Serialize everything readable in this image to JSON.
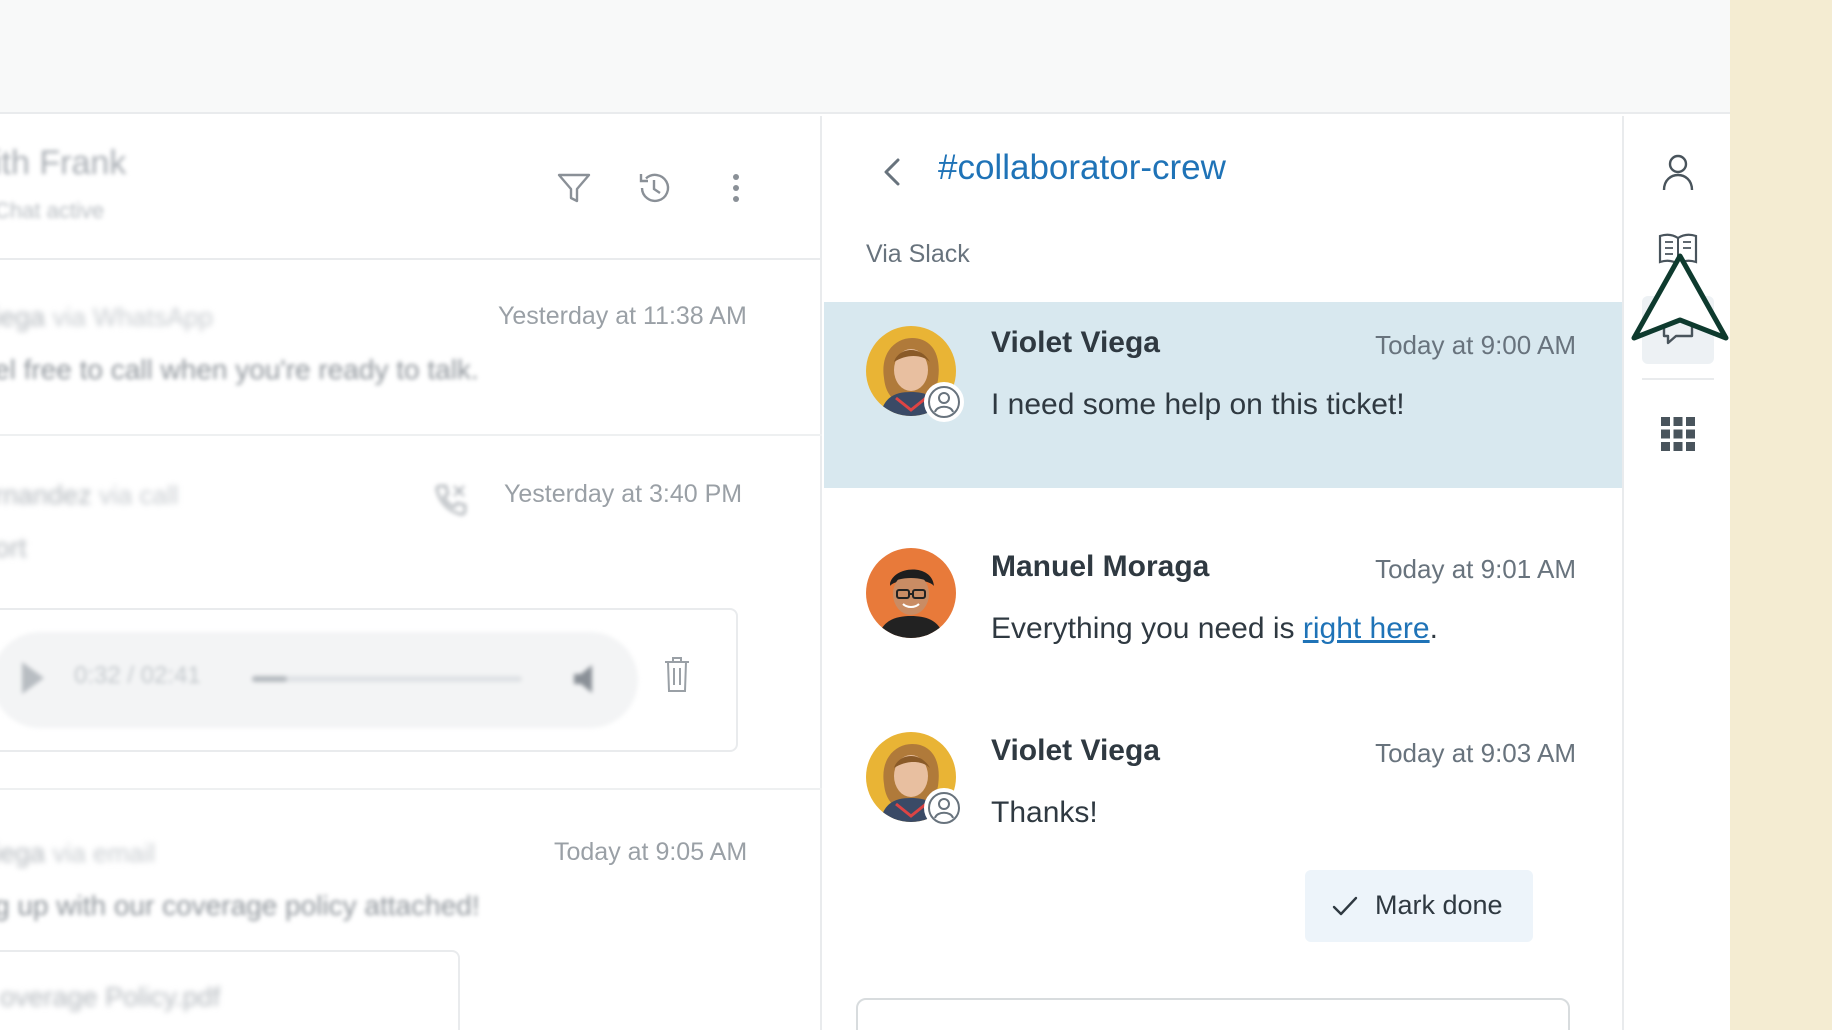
{
  "colors": {
    "accent": "#1f73b7",
    "highlight": "#d8e8ef",
    "background_side": "#f4ecd2"
  },
  "left_panel": {
    "title": "ith Frank",
    "status": "Chat active",
    "header_icons": [
      "filter-icon",
      "history-icon",
      "more-vertical-icon"
    ],
    "entries": [
      {
        "name": "iega",
        "via": "via WhatsApp",
        "time": "Yesterday at 11:38 AM",
        "text": "el free to call when you're ready to talk."
      },
      {
        "name": "rnandez",
        "via": "via call",
        "time": "Yesterday at 3:40 PM",
        "text": "ort",
        "icon": "call-icon",
        "audio": {
          "time": "0:32 / 02:41",
          "progress": 0.13
        }
      },
      {
        "name": "iega",
        "via": "via email",
        "time": "Today at 9:05 AM",
        "text": "g up with our coverage policy attached!",
        "attachment": "overage Policy.pdf"
      }
    ]
  },
  "thread": {
    "channel": "#collaborator-crew",
    "via": "Via Slack",
    "messages": [
      {
        "author": "Violet Viega",
        "time": "Today at 9:00 AM",
        "text": "I need some help on this ticket!",
        "highlighted": true,
        "avatar": "violet-avatar",
        "badge": "collaborator-icon"
      },
      {
        "author": "Manuel Moraga",
        "time": "Today at 9:01 AM",
        "text_before": "Everything you need is ",
        "link": "right here",
        "text_after": ".",
        "avatar": "manuel-avatar"
      },
      {
        "author": "Violet Viega",
        "time": "Today at 9:03 AM",
        "text": "Thanks!",
        "avatar": "violet-avatar",
        "badge": "collaborator-icon"
      }
    ],
    "mark_done_label": "Mark done"
  },
  "rail": {
    "icons": [
      "user-icon",
      "knowledge-icon",
      "conversations-icon",
      "apps-grid-icon"
    ],
    "active": "conversations-icon"
  }
}
